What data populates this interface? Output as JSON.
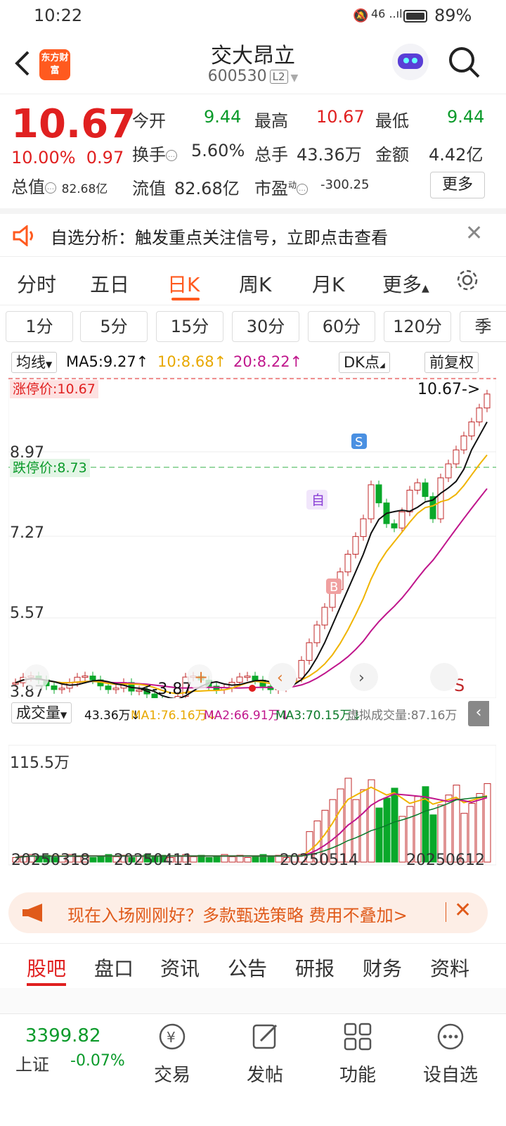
{
  "status": {
    "time": "10:22",
    "signal": "46 ..ıl",
    "battery": "89%"
  },
  "header": {
    "logo_text": "东方财富",
    "title": "交大昂立",
    "code": "600530",
    "level": "L2"
  },
  "quote": {
    "price": "10.67",
    "change_pct": "10.00%",
    "change": "0.97",
    "open_label": "今开",
    "open": "9.44",
    "high_label": "最高",
    "high": "10.67",
    "low_label": "最低",
    "low": "9.44",
    "turnover_label": "换手",
    "turnover": "5.60%",
    "vol_label": "总手",
    "vol": "43.36万",
    "amount_label": "金额",
    "amount": "4.42亿",
    "mcap_label": "总值",
    "mcap": "82.68亿",
    "float_label": "流值",
    "float": "82.68亿",
    "pe_label": "市盈",
    "pe_sup": "动",
    "pe": "-300.25",
    "more": "更多"
  },
  "notice": {
    "text": "自选分析：触发重点关注信号，立即点击查看"
  },
  "tabs": [
    "分时",
    "五日",
    "日K",
    "周K",
    "月K",
    "更多"
  ],
  "periods": [
    "1分",
    "5分",
    "15分",
    "30分",
    "60分",
    "120分",
    "季"
  ],
  "chart_bar": {
    "ma_select": "均线",
    "ma5": "MA5:9.27↑",
    "ma10": "10:8.68↑",
    "ma20": "20:8.22↑",
    "dk": "DK点",
    "fq": "前复权"
  },
  "kline_labels": {
    "limit_up": "涨停价:10.67",
    "limit_down": "跌停价:8.73",
    "y1": "10.67",
    "y2": "8.97",
    "y3": "7.27",
    "y4": "5.57",
    "y5": "3.87",
    "last": "10.67->",
    "low_mark": "<-3.87",
    "self": "自",
    "buy": "B",
    "sell": "S",
    "sig_s": "S"
  },
  "vol_bar": {
    "select": "成交量",
    "vol": "43.36万↓",
    "ma1": "MA1:76.16万↓",
    "ma2": "MA2:66.91万↓",
    "ma3": "MA3:70.15万↓",
    "virt": "虚拟成交量:87.16万"
  },
  "vol_labels": {
    "max": "115.5万"
  },
  "dates": [
    "20250318",
    "20250411",
    "20250514",
    "20250612"
  ],
  "promo": {
    "text": "现在入场刚刚好？多款甄选策略 费用不叠加>"
  },
  "bottom_tabs": [
    "股吧",
    "盘口",
    "资讯",
    "公告",
    "研报",
    "财务",
    "资料"
  ],
  "index": {
    "value": "3399.82",
    "name": "上证",
    "change": "-0.07%"
  },
  "nav": [
    "交易",
    "发帖",
    "功能",
    "设自选"
  ],
  "colors": {
    "up": "#e02020",
    "down": "#0a9a2a",
    "accent": "#ff5a1f",
    "ma5": "#111111",
    "ma10": "#f0b400",
    "ma20": "#c0168c"
  }
}
